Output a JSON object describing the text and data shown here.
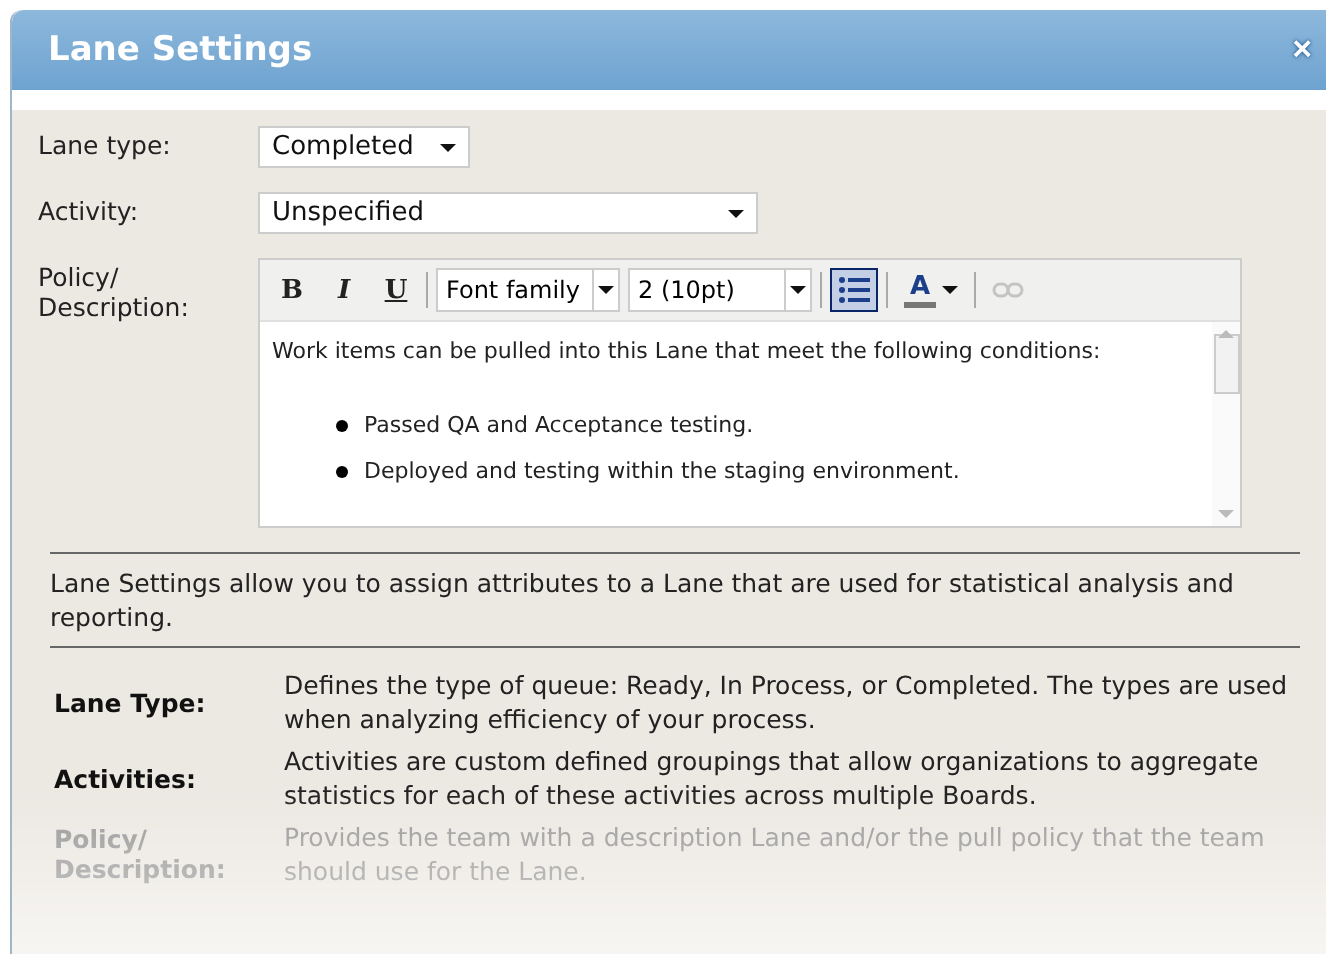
{
  "window": {
    "title": "Lane Settings",
    "close": "×"
  },
  "fields": [
    {
      "kind": "select",
      "label": "Lane type:",
      "value": "Completed",
      "wide": false
    },
    {
      "kind": "select",
      "label": "Activity:",
      "value": "Unspecified",
      "wide": true
    },
    {
      "kind": "editor",
      "label": "Policy/ Description:"
    }
  ],
  "editor": {
    "toolbar": [
      {
        "kind": "bold",
        "label": "B",
        "selected": false,
        "disabled": false
      },
      {
        "kind": "italic",
        "label": "I",
        "selected": false,
        "disabled": false
      },
      {
        "kind": "underline",
        "label": "U",
        "selected": false,
        "disabled": false
      },
      {
        "kind": "separator"
      },
      {
        "kind": "dropdown",
        "label": "Font family"
      },
      {
        "kind": "dropdown",
        "label": "2 (10pt)"
      },
      {
        "kind": "separator"
      },
      {
        "kind": "list",
        "selected": true,
        "disabled": false
      },
      {
        "kind": "separator"
      },
      {
        "kind": "color",
        "label": "A",
        "selected": false,
        "disabled": false
      },
      {
        "kind": "separator"
      },
      {
        "kind": "link",
        "selected": false,
        "disabled": true
      }
    ],
    "intro": "Work items can be pulled into this Lane that meet the following conditions:",
    "bullets": [
      "Passed QA and Acceptance testing.",
      "Deployed and testing within the staging environment."
    ]
  },
  "help": {
    "summary": "Lane Settings allow you to assign attributes to a Lane that are used for statistical analysis and reporting.",
    "rows": [
      {
        "term": "Lane Type:",
        "text": "Defines the type of queue: Ready, In Process, or Completed. The types are used when analyzing efficiency of your process."
      },
      {
        "term": "Activities:",
        "text": "Activities are custom defined groupings that allow organizations to aggregate statistics for each of these activities across multiple Boards."
      },
      {
        "term": "Policy/ Description:",
        "text": "Provides the team with a description Lane and/or the pull policy that the team should use for the Lane."
      }
    ]
  }
}
